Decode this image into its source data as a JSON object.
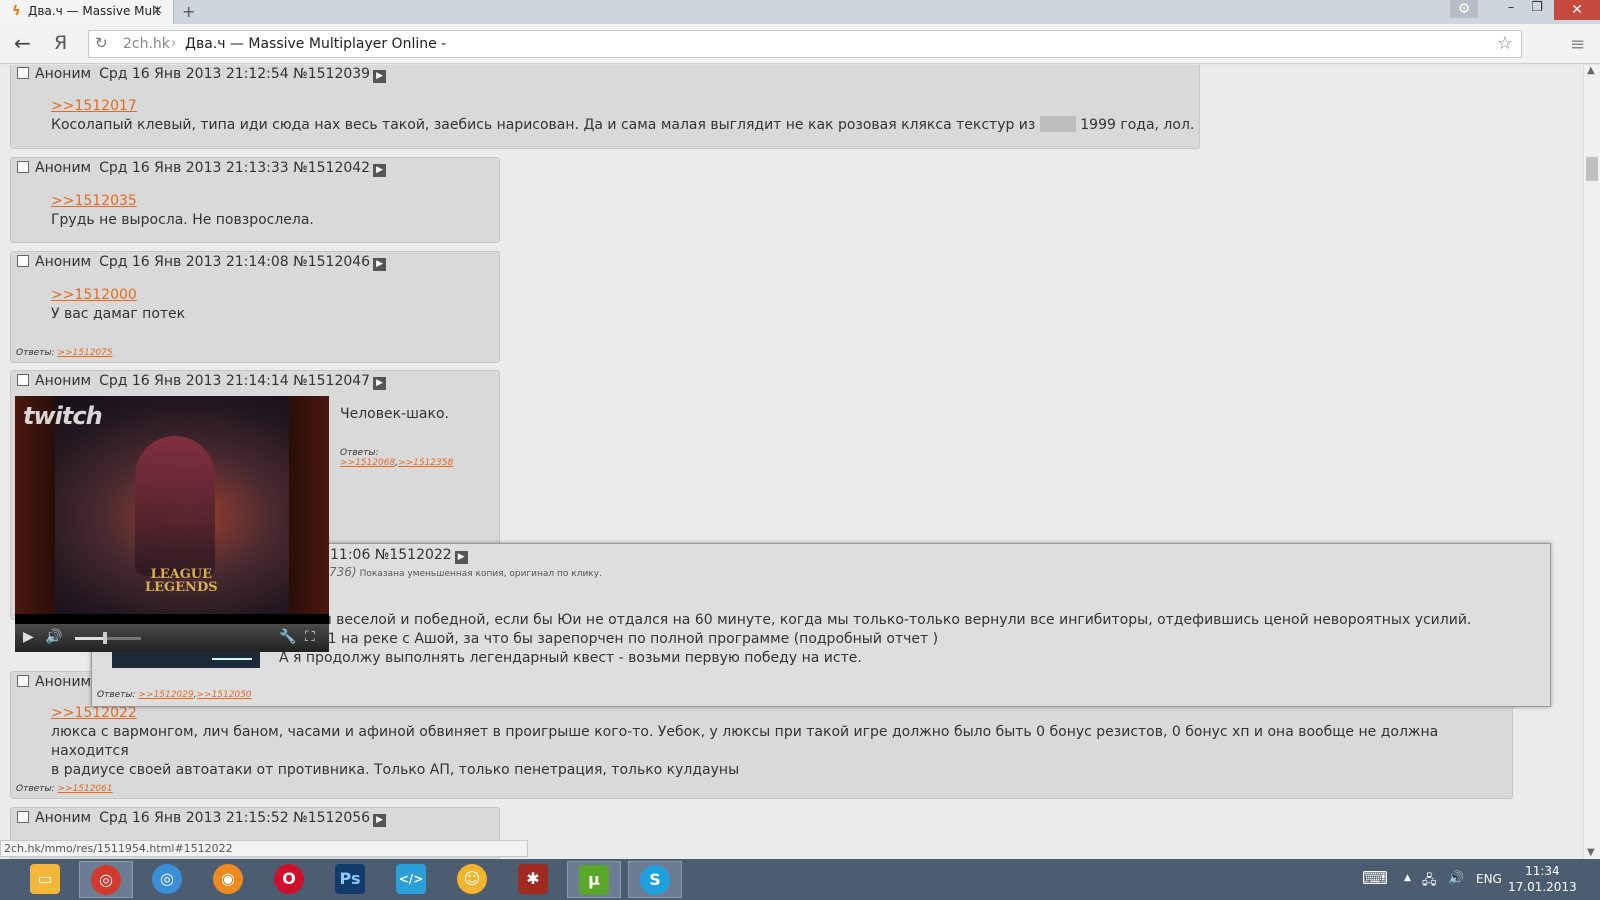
{
  "browser": {
    "tab_title": "Два.ч — Massive Mult",
    "tab_close": "×",
    "new_tab": "+",
    "url_host": "2ch.hk",
    "url_separator": "›",
    "url_title": "Два.ч — Massive Multiplayer Online -",
    "back_icon": "←",
    "yandex_icon": "Я",
    "reload_icon": "↻",
    "star_icon": "☆",
    "menu_icon": "≡",
    "settings_icon": "⚙",
    "minimize_icon": "–",
    "restore_icon": "❐",
    "close_icon": "✕"
  },
  "posts": [
    {
      "name": "Аноним",
      "date": "Срд 16 Янв 2013 21:12:54",
      "num": "№1512039",
      "reply_to": ">>1512017",
      "text_before": "Косолапый клевый, типа иди сюда нах весь такой, заебись нарисован. Да и сама малая выглядит не как розовая клякса текстур из",
      "text_after": "1999 года, лол."
    },
    {
      "name": "Аноним",
      "date": "Срд 16 Янв 2013 21:13:33",
      "num": "№1512042",
      "reply_to": ">>1512035",
      "text": "Грудь не выросла. Не повзрослела."
    },
    {
      "name": "Аноним",
      "date": "Срд 16 Янв 2013 21:14:08",
      "num": "№1512046",
      "reply_to": ">>1512000",
      "text": "У вас дамаг потек",
      "answers_label": "Ответы:",
      "answers": ">>1512075"
    },
    {
      "name": "Аноним",
      "date": "Срд 16 Янв 2013 21:14:14",
      "num": "№1512047",
      "text": "Человек-шако.",
      "answers_label": "Ответы:",
      "answers": [
        ">>1512068",
        ">>1512358"
      ],
      "answers_sep": ","
    },
    {
      "name": "Аноним",
      "reply_to": ">>1512022",
      "text_line1": "люкса с вармонгом, лич баном, часами и афиной обвиняет в проигрыше кого-то. Уебок, у люксы при такой игре должно было быть 0 бонус резистов, 0 бонус хп и она вообще не должна находится",
      "text_line2": "в радиусе своей автоатаки от противника. Только АП, только пенетрация, только кулдауны",
      "answers_label": "Ответы:",
      "answers": ">>1512061"
    },
    {
      "name": "Аноним",
      "date": "Срд 16 Янв 2013 21:15:52",
      "num": "№1512056"
    }
  ],
  "video": {
    "brand": "twitch",
    "game_logo_line1": "LEAGUE",
    "game_logo_line2": "LEGENDS",
    "play_icon": "▶",
    "volume_icon": "🔊",
    "volume_level": 0.45,
    "settings_icon": "🔧",
    "fullscreen_icon": "⛶"
  },
  "popup": {
    "head": "11:06 №1512022",
    "file_info": "736)",
    "file_note": "Показана уменьшенная копия, оригинал по клику.",
    "line1": "ыла бы веселой и победной, если бы Юи не отдался на 60 минуте, когда мы только-только вернули все ингибиторы, отдефившись ценой невороятных усилий.",
    "line2": "ёл 1на1 на реке с Ашой, за что бы зарепорчен по полной программе (подробный отчет )",
    "line3": "А я продолжу выполнять легендарный квест - возьми первую победу на исте.",
    "answers_label": "Ответы:",
    "answers": [
      ">>1512029",
      ">>1512050"
    ],
    "answers_sep": ","
  },
  "status_url": "2ch.hk/mmo/res/1511954.html#1512022",
  "taskbar": {
    "apps": [
      "file-explorer",
      "yandex-browser",
      "chrome",
      "firefox",
      "opera",
      "photoshop",
      "code-editor",
      "qip",
      "settings-app",
      "utorrent",
      "skype"
    ],
    "app_glyphs": [
      "▭",
      "◎",
      "◎",
      "◉",
      "O",
      "Ps",
      "</>",
      "☺",
      "✱",
      "µ",
      "S"
    ],
    "lang": "ENG",
    "time": "11:34",
    "date": "17.01.2013",
    "keyboard_icon": "⌨",
    "tray_up_icon": "▲",
    "network_icon": "🖧",
    "sound_icon": "🔊"
  },
  "colors": {
    "link": "#e66a20",
    "post_bg": "#d9d9d9",
    "page_bg": "#ebebeb",
    "taskbar": "#4c5d72",
    "close_red": "#c74a3e"
  }
}
